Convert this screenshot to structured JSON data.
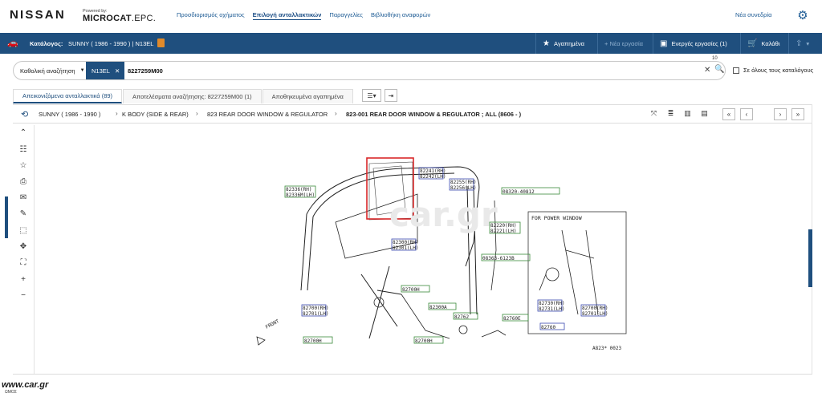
{
  "brand": {
    "nissan": "NISSAN",
    "powered_by": "Powered by:",
    "microcat": "MICROCAT",
    "epc": ".EPC."
  },
  "topnav": [
    {
      "label": "Προσδιορισμός οχήματος",
      "active": false
    },
    {
      "label": "Επιλογή ανταλλακτικών",
      "active": true
    },
    {
      "label": "Παραγγελίες",
      "active": false
    },
    {
      "label": "Βιβλιοθήκη αναφορών",
      "active": false
    }
  ],
  "new_session": "Νέα συνεδρία",
  "catalog": {
    "label": "Κατάλογος:",
    "value": "SUNNY ( 1986 - 1990 )  |  N13EL",
    "favorites": "Αγαπημένα",
    "new_job": "+ Νέα εργασία",
    "active_jobs": "Ενεργές εργασίες (1)",
    "basket": "Καλάθι"
  },
  "search": {
    "type": "Καθολική αναζήτηση",
    "chip": "N13EL",
    "value": "8227259M00",
    "count": "10",
    "all_catalogs": "Σε όλους τους καταλόγους"
  },
  "tabs": [
    {
      "label": "Απεικονιζόμενα ανταλλακτικά (89)",
      "active": true
    },
    {
      "label": "Αποτελέσματα αναζήτησης: 8227259M00 (1)",
      "active": false
    },
    {
      "label": "Αποθηκευμένα αγαπημένα",
      "active": false
    }
  ],
  "breadcrumb": [
    "SUNNY ( 1986 - 1990 )",
    "K BODY (SIDE & REAR)",
    "823 REAR DOOR WINDOW & REGULATOR",
    "823-001 REAR DOOR WINDOW & REGULATOR ; ALL (8606 - )"
  ],
  "diagram": {
    "title_box": "FOR POWER WINDOW",
    "code": "A823* 0023",
    "front": "FRONT",
    "labels": [
      "82241(RH)",
      "82242(LH)",
      "82336(RH)",
      "82336M(LH)",
      "82255(RH)",
      "82256(LH)",
      "08320-40812",
      "82220(RH)",
      "82221(LH)",
      "82300(RH)",
      "82301(LH)",
      "08363-6123B",
      "82700H",
      "82300A",
      "82700(RH)",
      "82701(LH)",
      "82762",
      "82760E",
      "82760",
      "82730(RH)",
      "82731(LH)",
      "82700(RH)",
      "82701(LH)",
      "82700H",
      "82700H"
    ],
    "accent_color": "#d8282a"
  },
  "watermark": {
    "site": "www.car.gr",
    "sub": "ΩΜΟΣ"
  },
  "colors": {
    "primary": "#1f4f7e",
    "link": "#1d5b94"
  }
}
